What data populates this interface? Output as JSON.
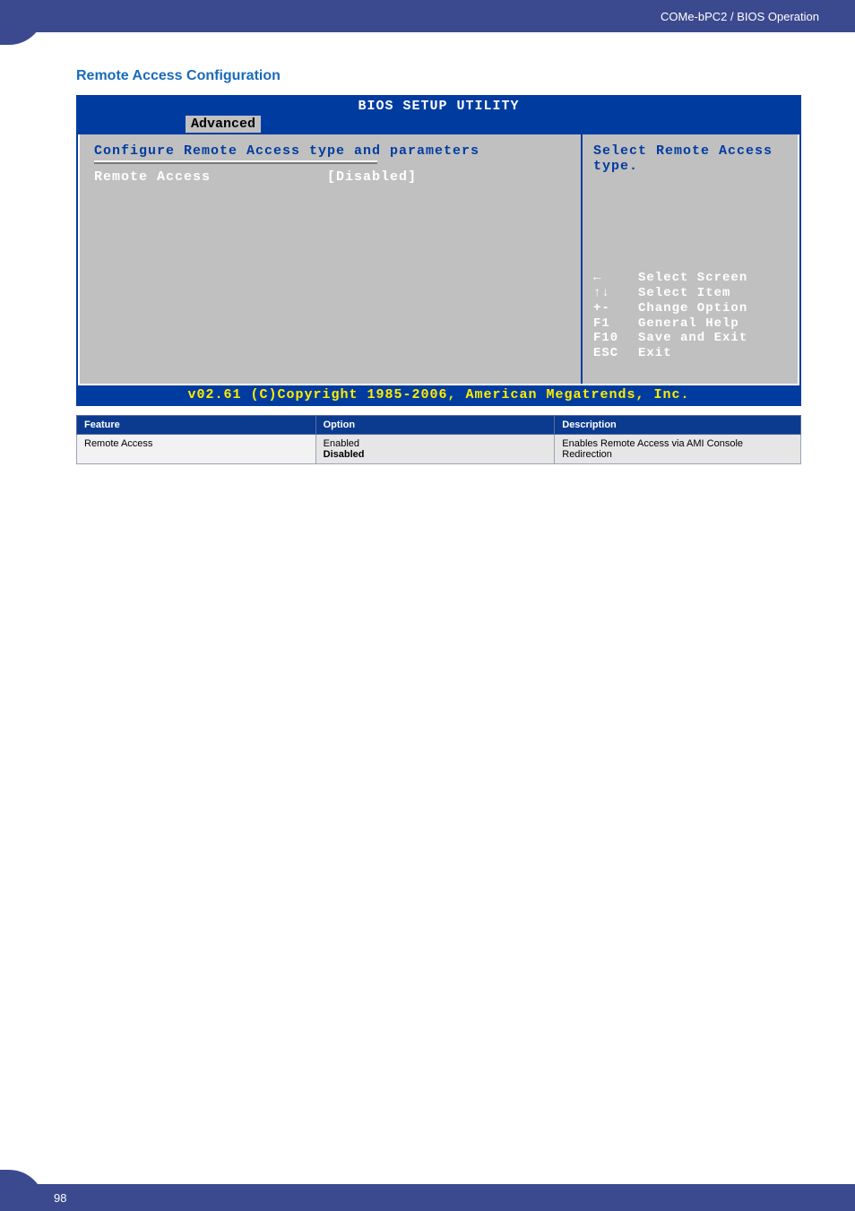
{
  "header": {
    "breadcrumb": "COMe-bPC2 / BIOS Operation"
  },
  "section": {
    "title": "Remote Access Configuration"
  },
  "bios": {
    "title": "BIOS SETUP UTILITY",
    "menu": {
      "active": "Advanced"
    },
    "left": {
      "heading": "Configure Remote Access type and parameters",
      "item_label": "Remote Access",
      "item_value": "[Disabled]"
    },
    "right": {
      "help_line1": "Select Remote Access",
      "help_line2": "type.",
      "keys": [
        {
          "sym": "←",
          "label": "Select Screen"
        },
        {
          "sym": "↑↓",
          "label": "Select Item"
        },
        {
          "sym": "+-",
          "label": "Change Option"
        },
        {
          "sym": "F1",
          "label": "General Help"
        },
        {
          "sym": "F10",
          "label": "Save and Exit"
        },
        {
          "sym": "ESC",
          "label": "Exit"
        }
      ]
    },
    "copyright": "v02.61 (C)Copyright 1985-2006, American Megatrends, Inc."
  },
  "table": {
    "headers": {
      "feature": "Feature",
      "option": "Option",
      "description": "Description"
    },
    "rows": [
      {
        "feature": "Remote Access",
        "option_line1": "Enabled",
        "option_line2": "Disabled",
        "description": "Enables Remote Access via AMI Console Redirection"
      }
    ]
  },
  "footer": {
    "page": "98"
  }
}
